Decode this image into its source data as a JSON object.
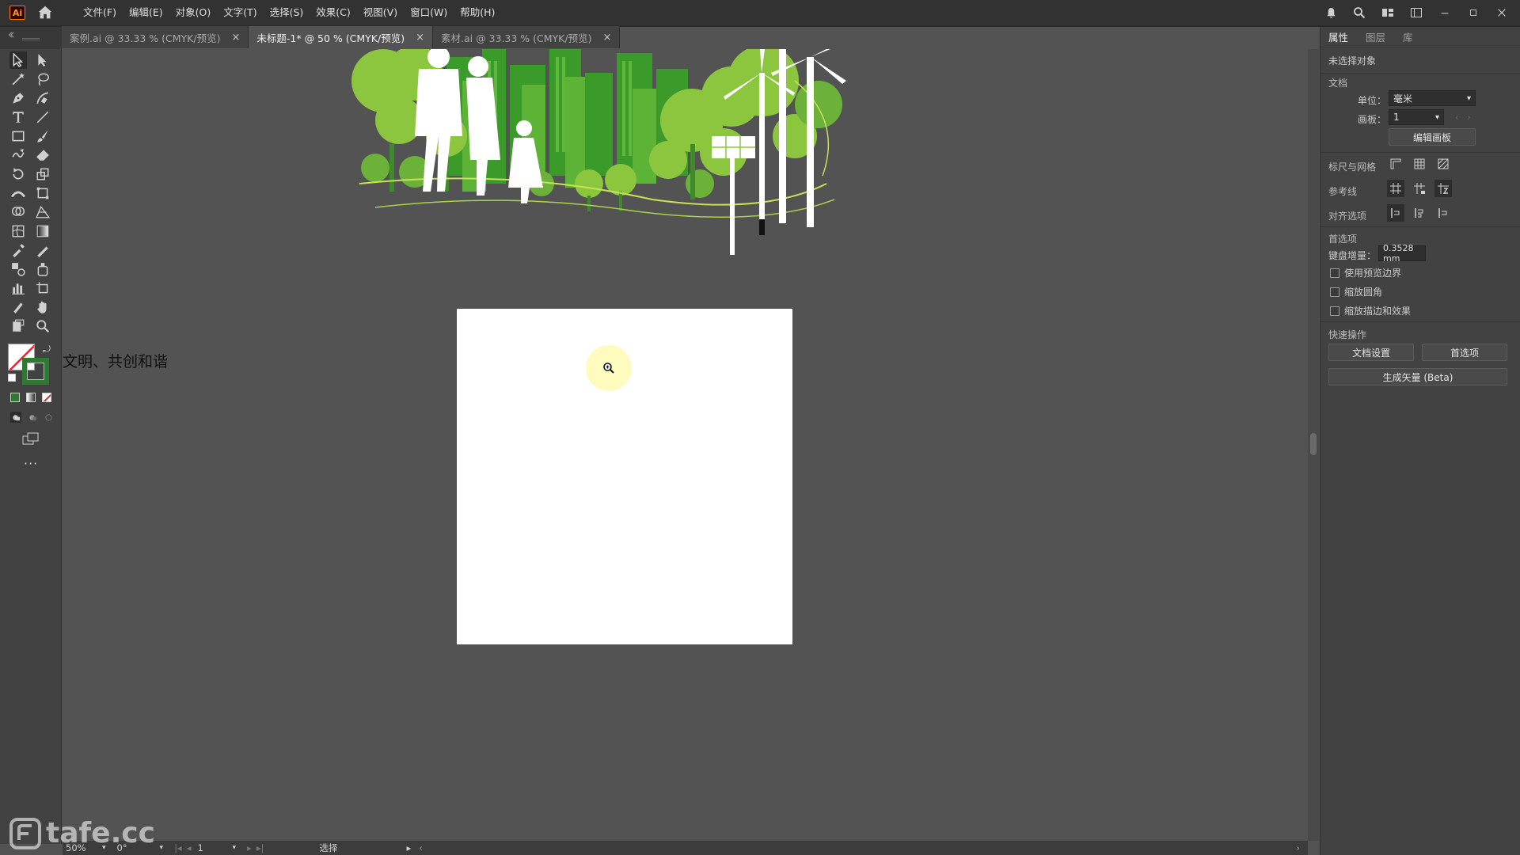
{
  "app": {
    "logo": "Ai"
  },
  "menu": [
    "文件(F)",
    "编辑(E)",
    "对象(O)",
    "文字(T)",
    "选择(S)",
    "效果(C)",
    "视图(V)",
    "窗口(W)",
    "帮助(H)"
  ],
  "tabs": [
    {
      "label": "案例.ai @ 33.33 % (CMYK/预览)",
      "active": false
    },
    {
      "label": "未标题-1* @ 50 % (CMYK/预览)",
      "active": true
    },
    {
      "label": "素材.ai @ 33.33 % (CMYK/预览)",
      "active": false
    }
  ],
  "canvas": {
    "floating_text": "文明、共创和谐"
  },
  "panel": {
    "tabs": [
      "属性",
      "图层",
      "库"
    ],
    "no_selection": "未选择对象",
    "document_section": "文档",
    "unit_label": "单位：",
    "unit_value": "毫米",
    "artboard_label": "画板：",
    "artboard_value": "1",
    "edit_artboard_button": "编辑画板",
    "rulers_grid_label": "标尺与网格",
    "guides_label": "参考线",
    "snap_label": "对齐选项",
    "preferences_section": "首选项",
    "keyboard_increment_label": "键盘增量：",
    "keyboard_increment_value": "0.3528 mm",
    "checkbox_preview_bounds": "使用预览边界",
    "checkbox_scale_corners": "缩放圆角",
    "checkbox_scale_strokes": "缩放描边和效果",
    "quick_actions_section": "快速操作",
    "doc_setup_button": "文档设置",
    "preferences_button": "首选项",
    "generate_vectors_button": "生成矢量 (Beta)"
  },
  "status": {
    "zoom": "50%",
    "rotation": "0°",
    "artboard_number": "1",
    "current_tool": "选择"
  },
  "watermark": "tafe.cc",
  "colors": {
    "menubar": "#323232",
    "panel": "#424242",
    "canvas": "#535353",
    "artwork_green": "#8cc63f",
    "artwork_dark_green": "#3a9a2a"
  }
}
